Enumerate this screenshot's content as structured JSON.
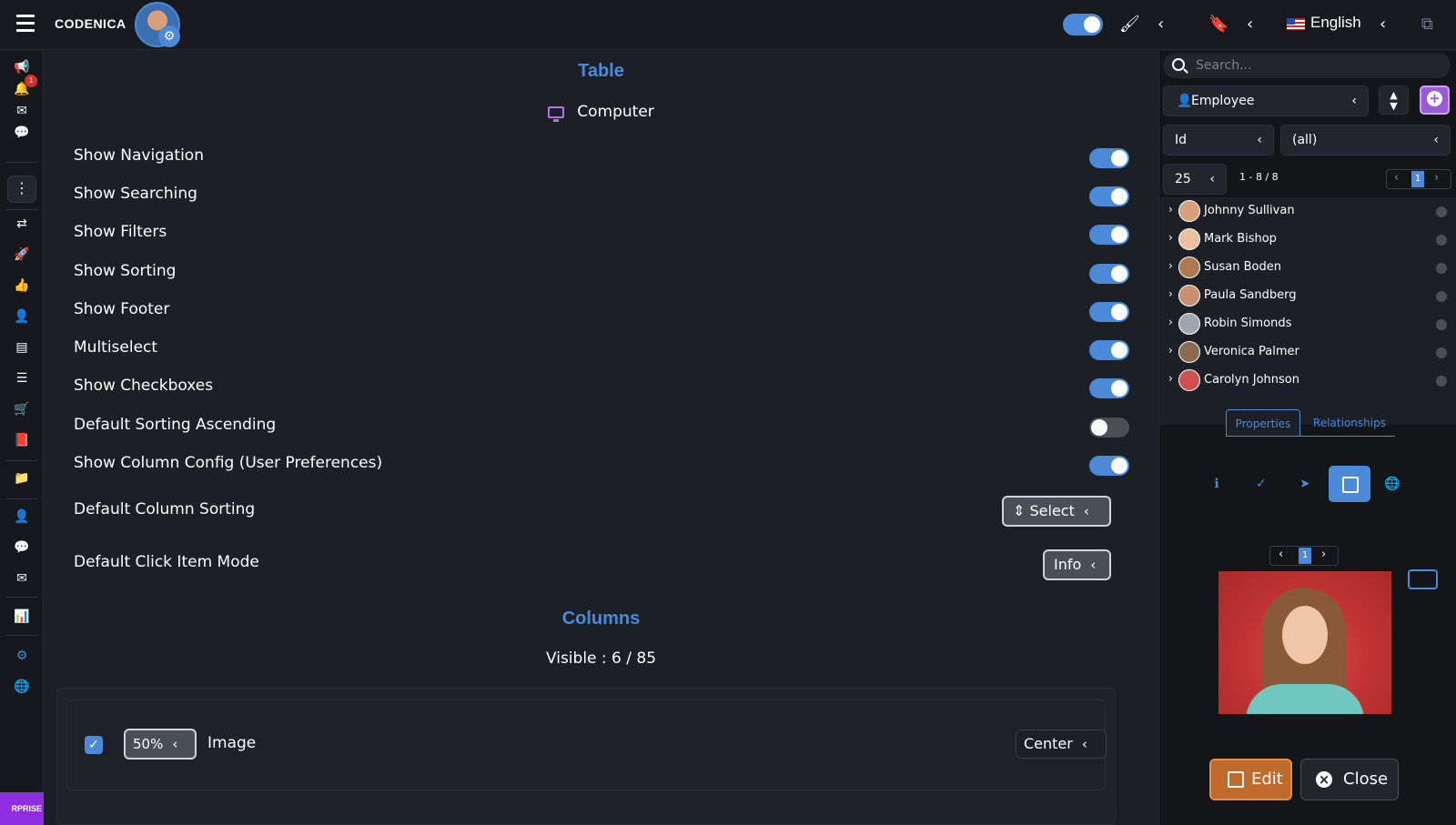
{
  "topbar": {
    "brand": "CODENICA",
    "language": "English"
  },
  "sidebar": {
    "notification_count": "1",
    "enterprise_label": "RPRISE"
  },
  "table_section": {
    "title": "Table",
    "device": "Computer",
    "options": [
      {
        "label": "Show Navigation",
        "on": true
      },
      {
        "label": "Show Searching",
        "on": true
      },
      {
        "label": "Show Filters",
        "on": true
      },
      {
        "label": "Show Sorting",
        "on": true
      },
      {
        "label": "Show Footer",
        "on": true
      },
      {
        "label": "Multiselect",
        "on": true
      },
      {
        "label": "Show Checkboxes",
        "on": true
      },
      {
        "label": "Default Sorting Ascending",
        "on": false
      },
      {
        "label": "Show Column Config (User Preferences)",
        "on": true
      }
    ],
    "default_column_sorting_label": "Default Column Sorting",
    "default_column_sorting_value": "Select",
    "default_click_mode_label": "Default Click Item Mode",
    "default_click_mode_value": "Info"
  },
  "columns_section": {
    "title": "Columns",
    "visible_text": "Visible : 6 / 85",
    "rows": [
      {
        "width": "50%",
        "name": "Image",
        "align": "Center",
        "checked": true
      }
    ]
  },
  "right_panel": {
    "search_placeholder": "Search...",
    "entity": "Employee",
    "filter_field": "Id",
    "filter_value": "(all)",
    "page_size": "25",
    "range": "1 - 8 / 8",
    "page": "1",
    "employees": [
      {
        "name": "Johnny Sullivan",
        "color": "#d8a07a"
      },
      {
        "name": "Mark Bishop",
        "color": "#e8c0a0"
      },
      {
        "name": "Susan Boden",
        "color": "#b07a50"
      },
      {
        "name": "Paula Sandberg",
        "color": "#c89070"
      },
      {
        "name": "Robin Simonds",
        "color": "#a0a6b0"
      },
      {
        "name": "Veronica Palmer",
        "color": "#8a6a50"
      },
      {
        "name": "Carolyn Johnson",
        "color": "#d05050"
      }
    ],
    "tabs": [
      "Properties",
      "Relationships"
    ],
    "image_page": "1",
    "edit_label": "Edit",
    "close_label": "Close"
  }
}
